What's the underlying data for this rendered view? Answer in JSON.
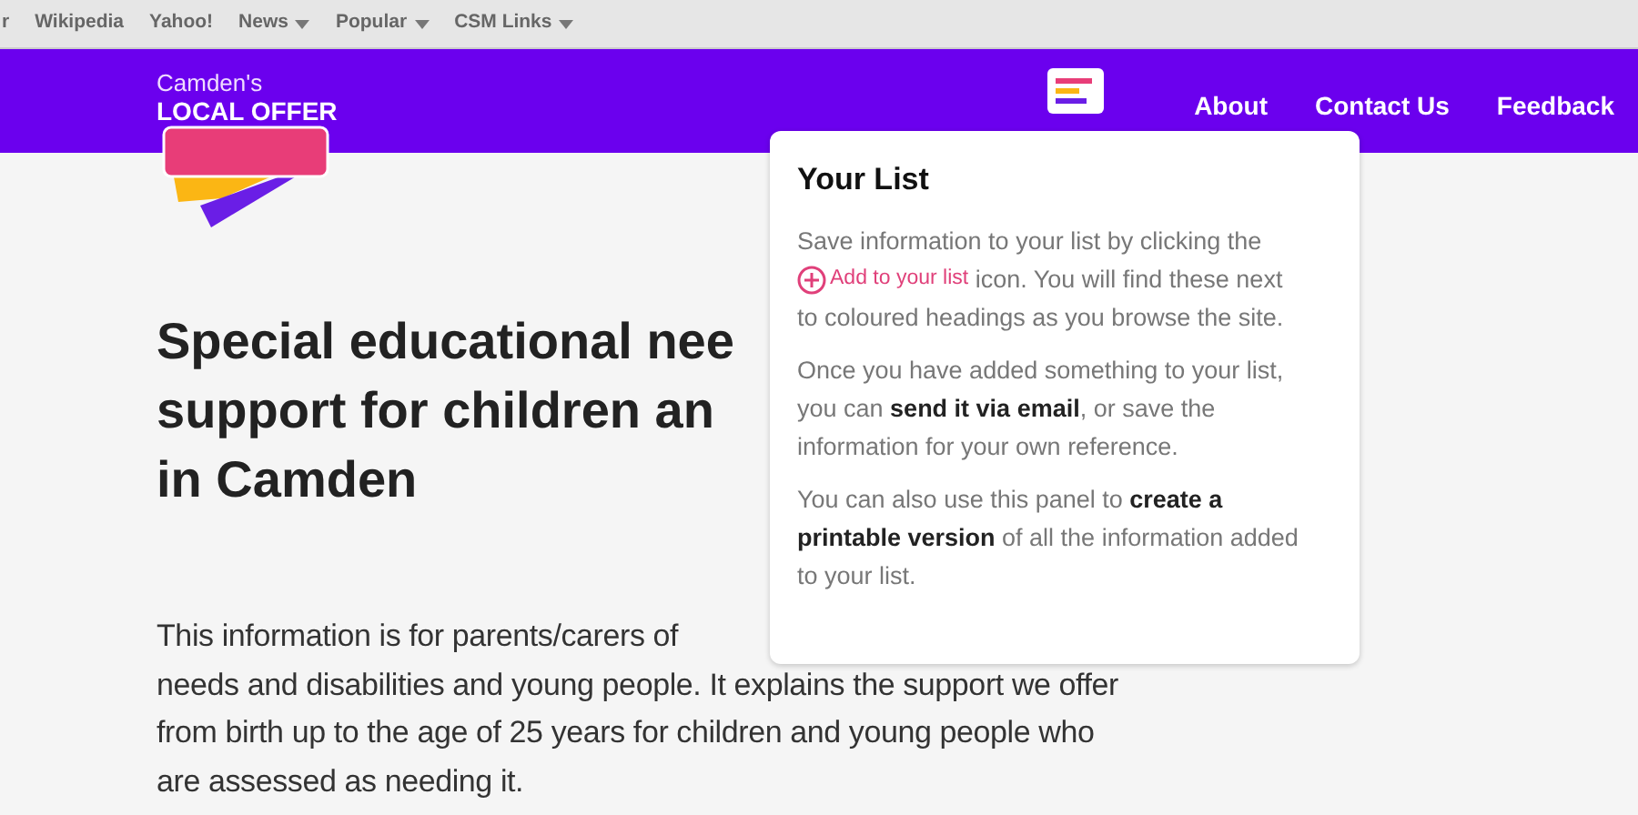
{
  "bookmarks": [
    {
      "label": "r",
      "menu": false
    },
    {
      "label": "Wikipedia",
      "menu": false
    },
    {
      "label": "Yahoo!",
      "menu": false
    },
    {
      "label": "News",
      "menu": true
    },
    {
      "label": "Popular",
      "menu": true
    },
    {
      "label": "CSM Links",
      "menu": true
    }
  ],
  "logo": {
    "line_1": "Camden's",
    "line_2": "LOCAL OFFER"
  },
  "nav": [
    "About",
    "Contact Us",
    "Feedback"
  ],
  "heading_lines": [
    "Special educational nee",
    "support for children an",
    "in Camden"
  ],
  "intro_lines": [
    "This information is for parents/carers of",
    "needs and disabilities and young people. It explains the support we offer",
    "from birth up to the age of 25 years for children and young people who",
    "are assessed as needing it."
  ],
  "panel": {
    "title": "Your List",
    "paragraphs": [
      {
        "before": "Save information to your list by clicking the",
        "link": "Add to your list",
        "after": "icon. You will find these next to coloured headings as you browse the site."
      },
      {
        "text": "Once you have added something to your list, you can **send it via email**, or save the information for your own reference."
      },
      {
        "text": "You can also use this panel to **create a printable version** of all the information added to your list."
      }
    ]
  }
}
